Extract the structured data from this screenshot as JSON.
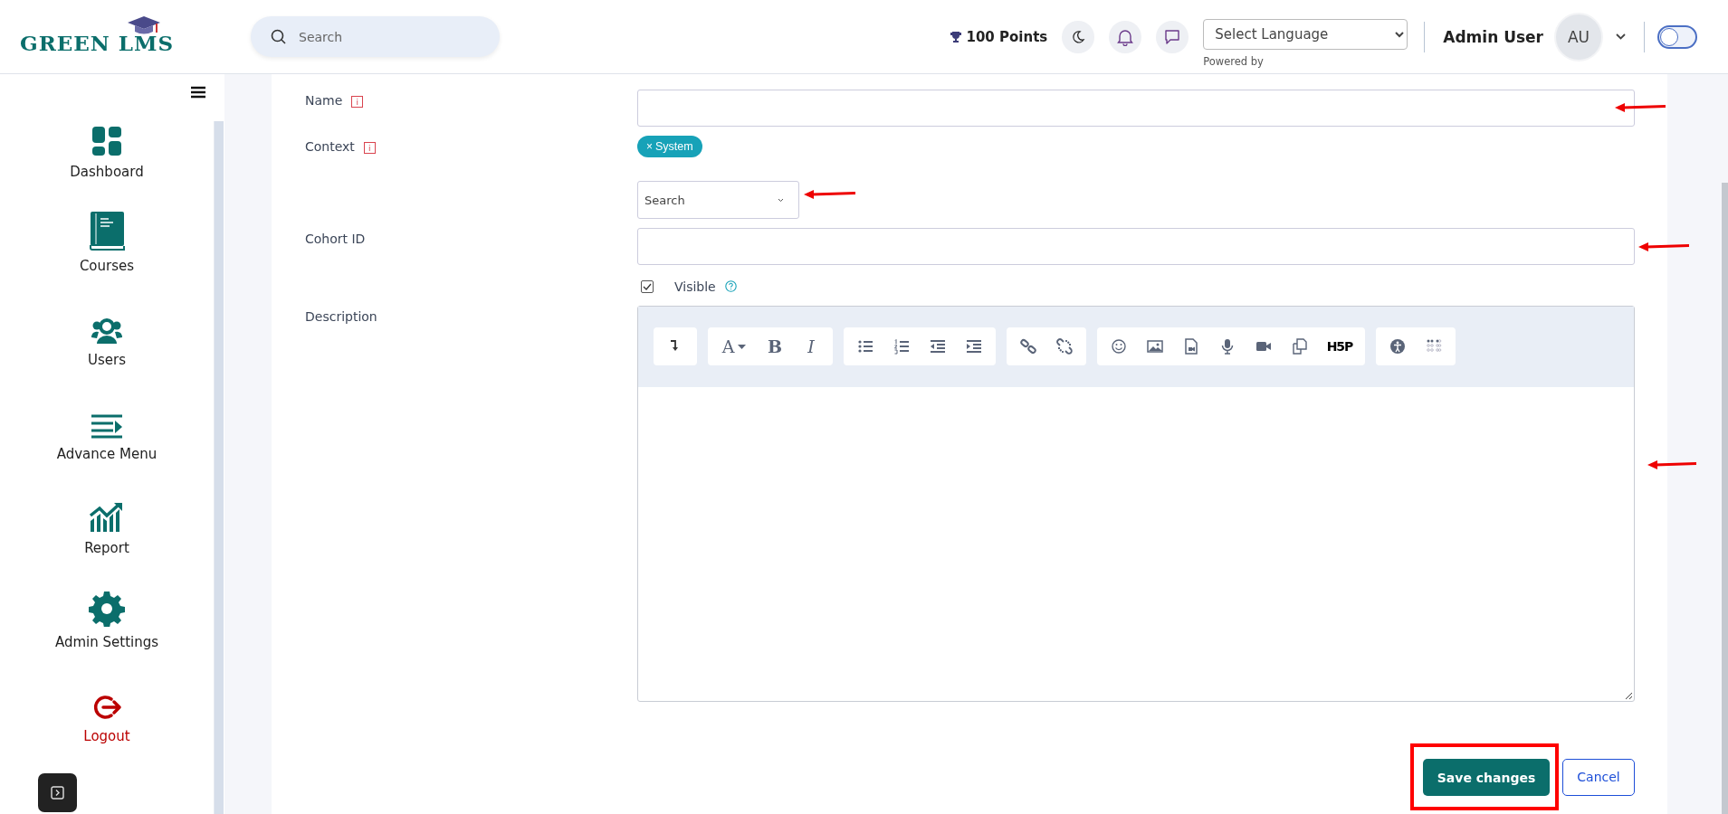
{
  "header": {
    "logo": "GREEN LMS",
    "search": {
      "placeholder": "Search"
    },
    "points": "100 Points",
    "language": {
      "value": "Select Language",
      "powered_by": "Powered by"
    },
    "user": {
      "name": "Admin User",
      "initials": "AU"
    },
    "toggle": {
      "on": false
    }
  },
  "sidebar": {
    "items": [
      {
        "label": "Dashboard",
        "kind": "nav"
      },
      {
        "label": "Courses",
        "kind": "nav"
      },
      {
        "label": "Users",
        "kind": "nav"
      },
      {
        "label": "Advance Menu",
        "kind": "nav"
      },
      {
        "label": "Report",
        "kind": "nav"
      },
      {
        "label": "Admin Settings",
        "kind": "nav"
      },
      {
        "label": "Logout",
        "kind": "logout"
      }
    ]
  },
  "form": {
    "name": {
      "label": "Name",
      "info": "i",
      "annotated": true
    },
    "context": {
      "label": "Context",
      "info": "i",
      "chip_remove": "×",
      "chip": "System",
      "search_placeholder": "Search",
      "annotated": true
    },
    "cohort_id": {
      "label": "Cohort ID",
      "annotated": true
    },
    "visible": {
      "label": "Visible",
      "checked": true
    },
    "description": {
      "label": "Description",
      "annotated": true,
      "toolbar": [
        {
          "items": [
            {
              "kind": "icon"
            }
          ]
        },
        {
          "items": [
            {
              "kind": "font",
              "text": "A"
            },
            {
              "kind": "bold",
              "text": "B"
            },
            {
              "kind": "italic",
              "text": "I"
            }
          ]
        },
        {
          "items": [
            {
              "kind": "icon"
            },
            {
              "kind": "icon"
            },
            {
              "kind": "icon"
            },
            {
              "kind": "icon"
            }
          ]
        },
        {
          "items": [
            {
              "kind": "icon"
            },
            {
              "kind": "icon"
            }
          ]
        },
        {
          "items": [
            {
              "kind": "icon"
            },
            {
              "kind": "icon"
            },
            {
              "kind": "icon"
            },
            {
              "kind": "icon"
            },
            {
              "kind": "icon"
            },
            {
              "kind": "icon"
            },
            {
              "kind": "logo",
              "text": "H5P"
            }
          ]
        },
        {
          "items": [
            {
              "kind": "icon"
            },
            {
              "kind": "icon"
            }
          ]
        }
      ]
    },
    "buttons": [
      {
        "label": "Save changes",
        "kind": "primary",
        "highlighted": true
      },
      {
        "label": "Cancel",
        "kind": "secondary",
        "highlighted": false
      }
    ]
  }
}
